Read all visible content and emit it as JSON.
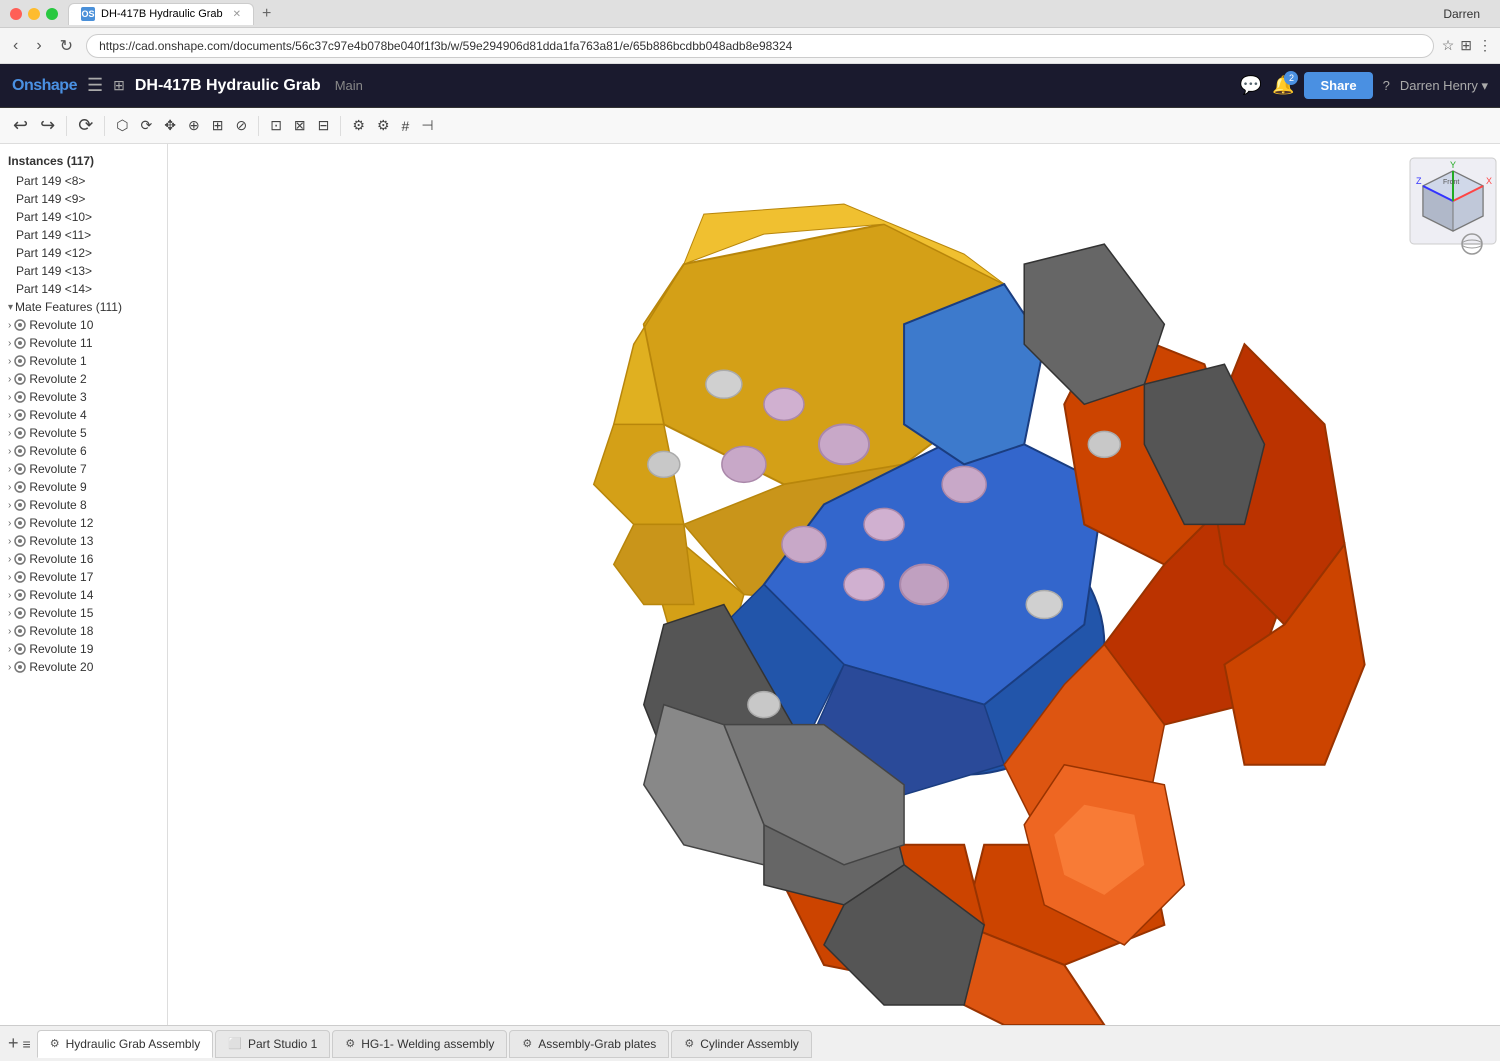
{
  "browser": {
    "tab_title": "DH-417B Hydraulic Grab",
    "tab_favicon": "OS",
    "url": "https://cad.onshape.com/documents/56c37c97e4b078be040f1f3b/w/59e294906d81dda1fa763a81/e/65b886bcdbb048adb8e98324",
    "user_label": "Darren"
  },
  "topnav": {
    "logo": "Onshape",
    "hamburger_icon": "☰",
    "doc_icon": "⊞",
    "title": "DH-417B Hydraulic Grab",
    "tab_label": "Main",
    "share_label": "Share",
    "help_label": "?",
    "user_label": "Darren Henry ▾",
    "notification_count": "2"
  },
  "sidebar": {
    "instances_header": "Instances (117)",
    "parts": [
      "Part 149 <8>",
      "Part 149 <9>",
      "Part 149 <10>",
      "Part 149 <11>",
      "Part 149 <12>",
      "Part 149 <13>",
      "Part 149 <14>"
    ],
    "mate_features_header": "Mate Features (111)",
    "revolutes": [
      "Revolute 10",
      "Revolute 11",
      "Revolute 1",
      "Revolute 2",
      "Revolute 3",
      "Revolute 4",
      "Revolute 5",
      "Revolute 6",
      "Revolute 7",
      "Revolute 9",
      "Revolute 8",
      "Revolute 12",
      "Revolute 13",
      "Revolute 16",
      "Revolute 17",
      "Revolute 14",
      "Revolute 15",
      "Revolute 18",
      "Revolute 19",
      "Revolute 20"
    ]
  },
  "bottom_tabs": [
    {
      "label": "Hydraulic Grab Assembly",
      "active": true,
      "icon": "⚙"
    },
    {
      "label": "Part Studio 1",
      "active": false,
      "icon": "⬜"
    },
    {
      "label": "HG-1- Welding assembly",
      "active": false,
      "icon": "⚙"
    },
    {
      "label": "Assembly-Grab plates",
      "active": false,
      "icon": "⚙"
    },
    {
      "label": "Cylinder Assembly",
      "active": false,
      "icon": "⚙"
    }
  ],
  "add_tab_icon": "+",
  "tabs_menu_icon": "≡"
}
